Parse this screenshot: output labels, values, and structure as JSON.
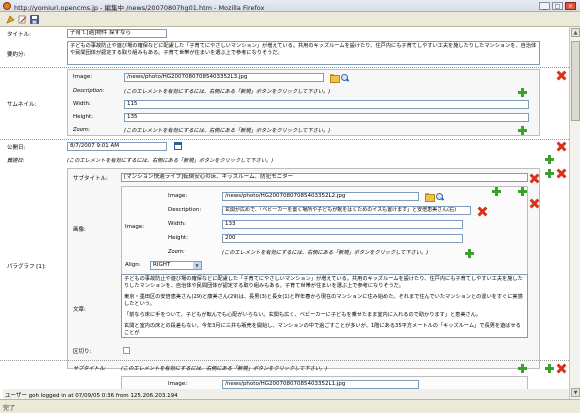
{
  "window": {
    "title": "http://yomiuri.opencms.jp - 編集中 /news/20070807hg01.htm - Mozilla Firefox",
    "minimize": "_",
    "maximize": "□",
    "close": "×"
  },
  "form": {
    "title_label": "タイトル:",
    "title_value": "子育て[適]物件 探すなら",
    "summary_label": "要約分:",
    "summary_value": "子どもの事故防止や遊び場の確保などに配慮した「子育てにやさしいマンション」が増えている。共用のキッズルームを設けたり、住戸内にも子育てしやすい工夫を施したりしたマンションを、自治体や民間団体が認定する取り組みもある。子育て世帯が住まいを選ぶ上で参考になりそうだ。",
    "thumbnail_label": "サムネイル:",
    "thumb_image_label": "Image:",
    "thumb_image_value": "/news/photo/HG20070807085403352L3.jpg",
    "thumb_desc_label": "Description:",
    "thumb_desc_note": "(このエレメントを有効にするには、右側にある「新規」ボタンをクリックして下さい。)",
    "thumb_width_label": "Width:",
    "thumb_width_value": "115",
    "thumb_height_label": "Height:",
    "thumb_height_value": "135",
    "thumb_zoom_label": "Zoom:",
    "thumb_zoom_note": "(このエレメントを有効にするには、右側にある「新規」ボタンをクリックして下さい。)",
    "pubdate_label": "公開日:",
    "pubdate_value": "8/7/2007 9:01 AM",
    "title2_label": "難題日:",
    "title2_note": "(このエレメントを有効にするには、右側にある「新規」ボタンをクリックして下さい。)",
    "paragraph_label": "パラグラフ [1]:",
    "para_subtitle_label": "サブタイトル:",
    "para_subtitle_value": "[マンション快適ライフ]転倒安心の床、キッズルーム、防犯モニター",
    "para_image_label": "画像:",
    "para_img_image_label": "Image:",
    "para_img_image_value": "/news/photo/HG20070807085403352L2.jpg",
    "para_img_desc_label": "Description:",
    "para_img_desc_value": "玄関が広めで、「ベビーカーを置く場所や子どもが靴をはくためのイスも置けます」と安倍恵美さん(右)",
    "para_img_width_label": "Width:",
    "para_img_width_value": "133",
    "para_img_height_label": "Height:",
    "para_img_height_value": "200",
    "para_img_zoom_label": "Zoom:",
    "para_img_zoom_note": "(このエレメントを有効にするには、右側にある「新規」ボタンをクリックして下さい。)",
    "align_label": "Align:",
    "align_value": "RIGHT",
    "body_label": "文章:",
    "body_paragraphs": [
      "子どもの事故防止や遊び場の確保などに配慮した「子育てにやさしいマンション」が増えている。共用のキッズルームを設けたり、住戸内にも子育てしやすい工夫を施したりしたマンションを、自治体や民間団体が認定する取り組みもある。子育て世帯が住まいを選ぶ上で参考になりそうだ。",
      "東京・墨田区の安倍恵美さん(29)と康美さん(29)は、長男(3)と長女(1)と昨年春から現在のマンションに住み始めた。それまで住んでいたマンションとの違いをすぐに実感したという。",
      "「前なら床に手をついて、子どもが転んでも心配がいらない。玄関も広く、ベビーカーに子どもを乗せたまま室内に入れるので助かります」と恵美さん。",
      "玄関と室内の床との段差もない。今年3月に三井も販売を開始し、マンションの中で過ごすことが多いが、1階にある35平方メートルの「キッズルーム」で長男を遊ばせることが"
    ],
    "kugiri_label": "区切り:",
    "sub2_label": "サブタイトル:",
    "sub2_note": "(このエレメントを有効にするには、右側にある「新規」ボタンをクリックして下さい。)",
    "img2_label": "Image:",
    "img2_value": "/news/photo/HG20070807085403352L1.jpg"
  },
  "status": {
    "user_line": "ユーザー  goh logged in at 07/09/05 0:36 from 125.206.203.194",
    "done": "完了"
  }
}
